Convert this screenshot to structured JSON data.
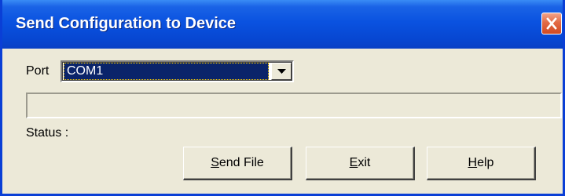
{
  "window": {
    "title": "Send Configuration to Device",
    "close_icon": "close-icon"
  },
  "port": {
    "label": "Port",
    "selected": "COM1",
    "dropdown_icon": "chevron-down-icon"
  },
  "progress": {
    "value": 0
  },
  "status": {
    "label": "Status :"
  },
  "buttons": {
    "send": {
      "mnemonic": "S",
      "rest": "end File",
      "label": "Send File"
    },
    "exit": {
      "mnemonic": "E",
      "rest": "xit",
      "label": "Exit"
    },
    "help": {
      "mnemonic": "H",
      "rest": "elp",
      "label": "Help"
    }
  },
  "colors": {
    "titlebar": "#0a52e0",
    "face": "#ece9d8",
    "selection": "#0a246a",
    "close": "#e26a45"
  }
}
